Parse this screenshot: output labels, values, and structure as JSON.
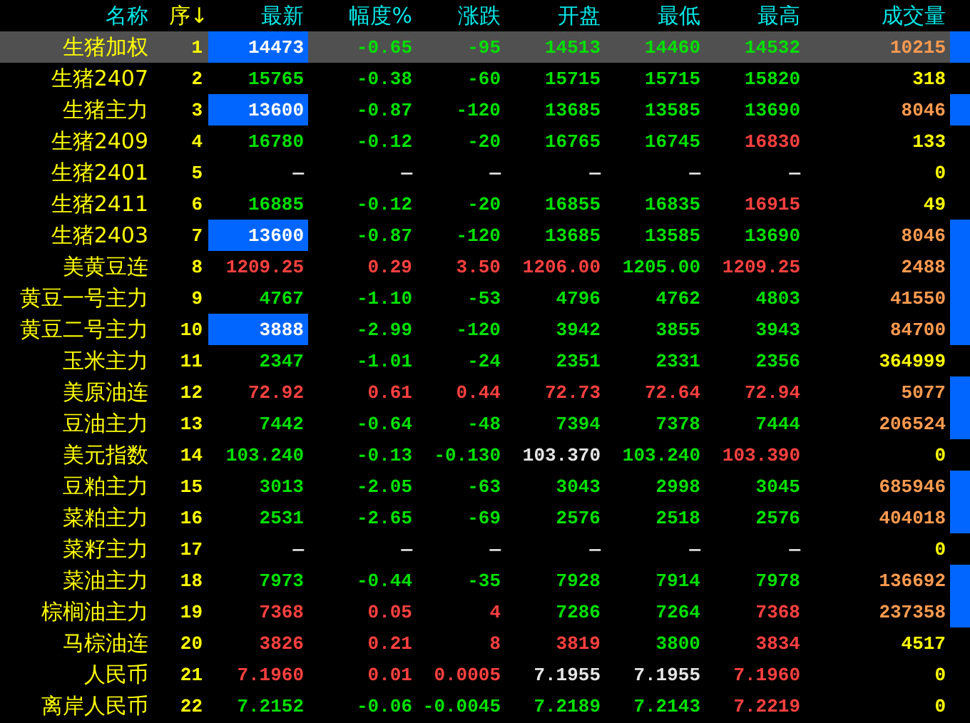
{
  "columns": [
    {
      "label": "名称",
      "kind": "plain"
    },
    {
      "label": "序↓",
      "kind": "sort"
    },
    {
      "label": "最新",
      "kind": "plain"
    },
    {
      "label": "幅度%",
      "kind": "plain"
    },
    {
      "label": "涨跌",
      "kind": "plain"
    },
    {
      "label": "开盘",
      "kind": "plain"
    },
    {
      "label": "最低",
      "kind": "plain"
    },
    {
      "label": "最高",
      "kind": "plain"
    },
    {
      "label": "成交量",
      "kind": "plain"
    }
  ],
  "rows": [
    {
      "name": "生猪加权",
      "seq": "1",
      "selected": true,
      "highlighted": true,
      "marked": true,
      "quotes": [
        {
          "text": "14473",
          "color": "#ffffff"
        },
        {
          "text": "-0.65",
          "color": "#00e000"
        },
        {
          "text": "-95",
          "color": "#00e000"
        },
        {
          "text": "14513",
          "color": "#00e000"
        },
        {
          "text": "14460",
          "color": "#00e000"
        },
        {
          "text": "14532",
          "color": "#00e000"
        }
      ],
      "volume": {
        "text": "10215",
        "color": "#ff9b50"
      }
    },
    {
      "name": "生猪2407",
      "seq": "2",
      "selected": false,
      "highlighted": false,
      "marked": false,
      "quotes": [
        {
          "text": "15765",
          "color": "#00e000"
        },
        {
          "text": "-0.38",
          "color": "#00e000"
        },
        {
          "text": "-60",
          "color": "#00e000"
        },
        {
          "text": "15715",
          "color": "#00e000"
        },
        {
          "text": "15715",
          "color": "#00e000"
        },
        {
          "text": "15820",
          "color": "#00e000"
        }
      ],
      "volume": {
        "text": "318",
        "color": "#ffff00"
      }
    },
    {
      "name": "生猪主力",
      "seq": "3",
      "selected": false,
      "highlighted": true,
      "marked": true,
      "quotes": [
        {
          "text": "13600",
          "color": "#ffffff"
        },
        {
          "text": "-0.87",
          "color": "#00e000"
        },
        {
          "text": "-120",
          "color": "#00e000"
        },
        {
          "text": "13685",
          "color": "#00e000"
        },
        {
          "text": "13585",
          "color": "#00e000"
        },
        {
          "text": "13690",
          "color": "#00e000"
        }
      ],
      "volume": {
        "text": "8046",
        "color": "#ff9b50"
      }
    },
    {
      "name": "生猪2409",
      "seq": "4",
      "selected": false,
      "highlighted": false,
      "marked": false,
      "quotes": [
        {
          "text": "16780",
          "color": "#00e000"
        },
        {
          "text": "-0.12",
          "color": "#00e000"
        },
        {
          "text": "-20",
          "color": "#00e000"
        },
        {
          "text": "16765",
          "color": "#00e000"
        },
        {
          "text": "16745",
          "color": "#00e000"
        },
        {
          "text": "16830",
          "color": "#ff4040"
        }
      ],
      "volume": {
        "text": "133",
        "color": "#ffff00"
      }
    },
    {
      "name": "生猪2401",
      "seq": "5",
      "selected": false,
      "highlighted": false,
      "marked": false,
      "quotes": [
        {
          "text": "—",
          "color": "#e6e6e6"
        },
        {
          "text": "—",
          "color": "#e6e6e6"
        },
        {
          "text": "—",
          "color": "#e6e6e6"
        },
        {
          "text": "—",
          "color": "#e6e6e6"
        },
        {
          "text": "—",
          "color": "#e6e6e6"
        },
        {
          "text": "—",
          "color": "#e6e6e6"
        }
      ],
      "volume": {
        "text": "0",
        "color": "#ffff00"
      }
    },
    {
      "name": "生猪2411",
      "seq": "6",
      "selected": false,
      "highlighted": false,
      "marked": false,
      "quotes": [
        {
          "text": "16885",
          "color": "#00e000"
        },
        {
          "text": "-0.12",
          "color": "#00e000"
        },
        {
          "text": "-20",
          "color": "#00e000"
        },
        {
          "text": "16855",
          "color": "#00e000"
        },
        {
          "text": "16835",
          "color": "#00e000"
        },
        {
          "text": "16915",
          "color": "#ff4040"
        }
      ],
      "volume": {
        "text": "49",
        "color": "#ffff00"
      }
    },
    {
      "name": "生猪2403",
      "seq": "7",
      "selected": false,
      "highlighted": true,
      "marked": true,
      "quotes": [
        {
          "text": "13600",
          "color": "#ffffff"
        },
        {
          "text": "-0.87",
          "color": "#00e000"
        },
        {
          "text": "-120",
          "color": "#00e000"
        },
        {
          "text": "13685",
          "color": "#00e000"
        },
        {
          "text": "13585",
          "color": "#00e000"
        },
        {
          "text": "13690",
          "color": "#00e000"
        }
      ],
      "volume": {
        "text": "8046",
        "color": "#ff9b50"
      }
    },
    {
      "name": "美黄豆连",
      "seq": "8",
      "selected": false,
      "highlighted": false,
      "marked": true,
      "quotes": [
        {
          "text": "1209.25",
          "color": "#ff4040"
        },
        {
          "text": "0.29",
          "color": "#ff4040"
        },
        {
          "text": "3.50",
          "color": "#ff4040"
        },
        {
          "text": "1206.00",
          "color": "#ff4040"
        },
        {
          "text": "1205.00",
          "color": "#00e000"
        },
        {
          "text": "1209.25",
          "color": "#ff4040"
        }
      ],
      "volume": {
        "text": "2488",
        "color": "#ff9b50"
      }
    },
    {
      "name": "黄豆一号主力",
      "seq": "9",
      "selected": false,
      "highlighted": false,
      "marked": true,
      "quotes": [
        {
          "text": "4767",
          "color": "#00e000"
        },
        {
          "text": "-1.10",
          "color": "#00e000"
        },
        {
          "text": "-53",
          "color": "#00e000"
        },
        {
          "text": "4796",
          "color": "#00e000"
        },
        {
          "text": "4762",
          "color": "#00e000"
        },
        {
          "text": "4803",
          "color": "#00e000"
        }
      ],
      "volume": {
        "text": "41550",
        "color": "#ff9b50"
      }
    },
    {
      "name": "黄豆二号主力",
      "seq": "10",
      "selected": false,
      "highlighted": true,
      "marked": true,
      "quotes": [
        {
          "text": "3888",
          "color": "#ffffff"
        },
        {
          "text": "-2.99",
          "color": "#00e000"
        },
        {
          "text": "-120",
          "color": "#00e000"
        },
        {
          "text": "3942",
          "color": "#00e000"
        },
        {
          "text": "3855",
          "color": "#00e000"
        },
        {
          "text": "3943",
          "color": "#00e000"
        }
      ],
      "volume": {
        "text": "84700",
        "color": "#ff9b50"
      }
    },
    {
      "name": "玉米主力",
      "seq": "11",
      "selected": false,
      "highlighted": false,
      "marked": false,
      "quotes": [
        {
          "text": "2347",
          "color": "#00e000"
        },
        {
          "text": "-1.01",
          "color": "#00e000"
        },
        {
          "text": "-24",
          "color": "#00e000"
        },
        {
          "text": "2351",
          "color": "#00e000"
        },
        {
          "text": "2331",
          "color": "#00e000"
        },
        {
          "text": "2356",
          "color": "#00e000"
        }
      ],
      "volume": {
        "text": "364999",
        "color": "#ffff00"
      }
    },
    {
      "name": "美原油连",
      "seq": "12",
      "selected": false,
      "highlighted": false,
      "marked": true,
      "quotes": [
        {
          "text": "72.92",
          "color": "#ff4040"
        },
        {
          "text": "0.61",
          "color": "#ff4040"
        },
        {
          "text": "0.44",
          "color": "#ff4040"
        },
        {
          "text": "72.73",
          "color": "#ff4040"
        },
        {
          "text": "72.64",
          "color": "#ff4040"
        },
        {
          "text": "72.94",
          "color": "#ff4040"
        }
      ],
      "volume": {
        "text": "5077",
        "color": "#ff9b50"
      }
    },
    {
      "name": "豆油主力",
      "seq": "13",
      "selected": false,
      "highlighted": false,
      "marked": true,
      "quotes": [
        {
          "text": "7442",
          "color": "#00e000"
        },
        {
          "text": "-0.64",
          "color": "#00e000"
        },
        {
          "text": "-48",
          "color": "#00e000"
        },
        {
          "text": "7394",
          "color": "#00e000"
        },
        {
          "text": "7378",
          "color": "#00e000"
        },
        {
          "text": "7444",
          "color": "#00e000"
        }
      ],
      "volume": {
        "text": "206524",
        "color": "#ff9b50"
      }
    },
    {
      "name": "美元指数",
      "seq": "14",
      "selected": false,
      "highlighted": false,
      "marked": false,
      "quotes": [
        {
          "text": "103.240",
          "color": "#00e000"
        },
        {
          "text": "-0.13",
          "color": "#00e000"
        },
        {
          "text": "-0.130",
          "color": "#00e000"
        },
        {
          "text": "103.370",
          "color": "#e6e6e6"
        },
        {
          "text": "103.240",
          "color": "#00e000"
        },
        {
          "text": "103.390",
          "color": "#ff4040"
        }
      ],
      "volume": {
        "text": "0",
        "color": "#ffff00"
      }
    },
    {
      "name": "豆粕主力",
      "seq": "15",
      "selected": false,
      "highlighted": false,
      "marked": true,
      "quotes": [
        {
          "text": "3013",
          "color": "#00e000"
        },
        {
          "text": "-2.05",
          "color": "#00e000"
        },
        {
          "text": "-63",
          "color": "#00e000"
        },
        {
          "text": "3043",
          "color": "#00e000"
        },
        {
          "text": "2998",
          "color": "#00e000"
        },
        {
          "text": "3045",
          "color": "#00e000"
        }
      ],
      "volume": {
        "text": "685946",
        "color": "#ff9b50"
      }
    },
    {
      "name": "菜粕主力",
      "seq": "16",
      "selected": false,
      "highlighted": false,
      "marked": true,
      "quotes": [
        {
          "text": "2531",
          "color": "#00e000"
        },
        {
          "text": "-2.65",
          "color": "#00e000"
        },
        {
          "text": "-69",
          "color": "#00e000"
        },
        {
          "text": "2576",
          "color": "#00e000"
        },
        {
          "text": "2518",
          "color": "#00e000"
        },
        {
          "text": "2576",
          "color": "#00e000"
        }
      ],
      "volume": {
        "text": "404018",
        "color": "#ff9b50"
      }
    },
    {
      "name": "菜籽主力",
      "seq": "17",
      "selected": false,
      "highlighted": false,
      "marked": false,
      "quotes": [
        {
          "text": "—",
          "color": "#e6e6e6"
        },
        {
          "text": "—",
          "color": "#e6e6e6"
        },
        {
          "text": "—",
          "color": "#e6e6e6"
        },
        {
          "text": "—",
          "color": "#e6e6e6"
        },
        {
          "text": "—",
          "color": "#e6e6e6"
        },
        {
          "text": "—",
          "color": "#e6e6e6"
        }
      ],
      "volume": {
        "text": "0",
        "color": "#ffff00"
      }
    },
    {
      "name": "菜油主力",
      "seq": "18",
      "selected": false,
      "highlighted": false,
      "marked": true,
      "quotes": [
        {
          "text": "7973",
          "color": "#00e000"
        },
        {
          "text": "-0.44",
          "color": "#00e000"
        },
        {
          "text": "-35",
          "color": "#00e000"
        },
        {
          "text": "7928",
          "color": "#00e000"
        },
        {
          "text": "7914",
          "color": "#00e000"
        },
        {
          "text": "7978",
          "color": "#00e000"
        }
      ],
      "volume": {
        "text": "136692",
        "color": "#ff9b50"
      }
    },
    {
      "name": "棕榈油主力",
      "seq": "19",
      "selected": false,
      "highlighted": false,
      "marked": true,
      "quotes": [
        {
          "text": "7368",
          "color": "#ff4040"
        },
        {
          "text": "0.05",
          "color": "#ff4040"
        },
        {
          "text": "4",
          "color": "#ff4040"
        },
        {
          "text": "7286",
          "color": "#00e000"
        },
        {
          "text": "7264",
          "color": "#00e000"
        },
        {
          "text": "7368",
          "color": "#ff4040"
        }
      ],
      "volume": {
        "text": "237358",
        "color": "#ff9b50"
      }
    },
    {
      "name": "马棕油连",
      "seq": "20",
      "selected": false,
      "highlighted": false,
      "marked": false,
      "quotes": [
        {
          "text": "3826",
          "color": "#ff4040"
        },
        {
          "text": "0.21",
          "color": "#ff4040"
        },
        {
          "text": "8",
          "color": "#ff4040"
        },
        {
          "text": "3819",
          "color": "#ff4040"
        },
        {
          "text": "3800",
          "color": "#00e000"
        },
        {
          "text": "3834",
          "color": "#ff4040"
        }
      ],
      "volume": {
        "text": "4517",
        "color": "#ffff00"
      }
    },
    {
      "name": "人民币",
      "seq": "21",
      "selected": false,
      "highlighted": false,
      "marked": false,
      "quotes": [
        {
          "text": "7.1960",
          "color": "#ff4040"
        },
        {
          "text": "0.01",
          "color": "#ff4040"
        },
        {
          "text": "0.0005",
          "color": "#ff4040"
        },
        {
          "text": "7.1955",
          "color": "#e6e6e6"
        },
        {
          "text": "7.1955",
          "color": "#e6e6e6"
        },
        {
          "text": "7.1960",
          "color": "#ff4040"
        }
      ],
      "volume": {
        "text": "0",
        "color": "#ffff00"
      }
    },
    {
      "name": "离岸人民币",
      "seq": "22",
      "selected": false,
      "highlighted": false,
      "marked": false,
      "quotes": [
        {
          "text": "7.2152",
          "color": "#00e000"
        },
        {
          "text": "-0.06",
          "color": "#00e000"
        },
        {
          "text": "-0.0045",
          "color": "#00e000"
        },
        {
          "text": "7.2189",
          "color": "#00e000"
        },
        {
          "text": "7.2143",
          "color": "#00e000"
        },
        {
          "text": "7.2219",
          "color": "#ff4040"
        }
      ],
      "volume": {
        "text": "0",
        "color": "#ffff00"
      }
    }
  ]
}
